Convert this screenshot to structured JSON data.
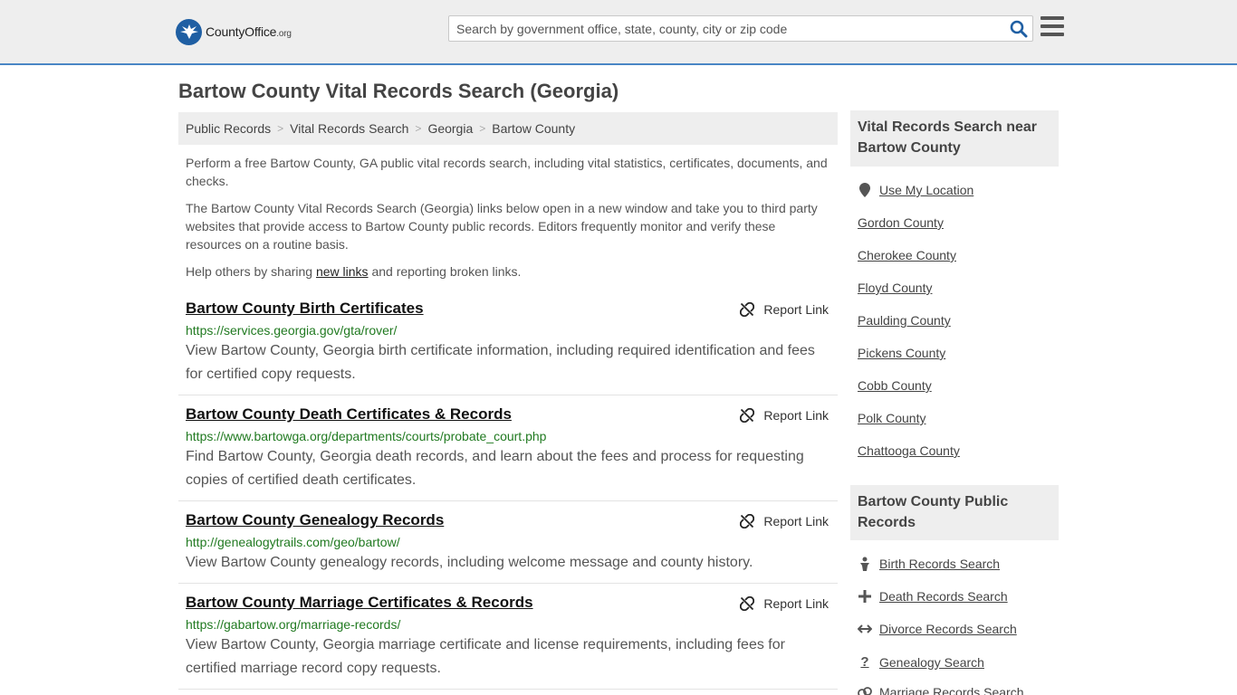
{
  "header": {
    "logo_brand": "CountyOffice",
    "logo_tld": ".org",
    "search_placeholder": "Search by government office, state, county, city or zip code"
  },
  "page_title": "Bartow County Vital Records Search (Georgia)",
  "breadcrumb": [
    "Public Records",
    "Vital Records Search",
    "Georgia",
    "Bartow County"
  ],
  "intro": {
    "p1": "Perform a free Bartow County, GA public vital records search, including vital statistics, certificates, documents, and checks.",
    "p2": "The Bartow County Vital Records Search (Georgia) links below open in a new window and take you to third party websites that provide access to Bartow County public records. Editors frequently monitor and verify these resources on a routine basis.",
    "p3_before": "Help others by sharing ",
    "p3_link": "new links",
    "p3_after": " and reporting broken links."
  },
  "report_label": "Report Link",
  "results": [
    {
      "title": "Bartow County Birth Certificates",
      "url": "https://services.georgia.gov/gta/rover/",
      "desc": "View Bartow County, Georgia birth certificate information, including required identification and fees for certified copy requests."
    },
    {
      "title": "Bartow County Death Certificates & Records",
      "url": "https://www.bartowga.org/departments/courts/probate_court.php",
      "desc": "Find Bartow County, Georgia death records, and learn about the fees and process for requesting copies of certified death certificates."
    },
    {
      "title": "Bartow County Genealogy Records",
      "url": "http://genealogytrails.com/geo/bartow/",
      "desc": "View Bartow County genealogy records, including welcome message and county history."
    },
    {
      "title": "Bartow County Marriage Certificates & Records",
      "url": "https://gabartow.org/marriage-records/",
      "desc": "View Bartow County, Georgia marriage certificate and license requirements, including fees for certified marriage record copy requests."
    }
  ],
  "sidebar": {
    "nearby_heading": "Vital Records Search near Bartow County",
    "use_location": "Use My Location",
    "nearby": [
      "Gordon County",
      "Cherokee County",
      "Floyd County",
      "Paulding County",
      "Pickens County",
      "Cobb County",
      "Polk County",
      "Chattooga County"
    ],
    "public_heading": "Bartow County Public Records",
    "public_links": [
      {
        "label": "Birth Records Search",
        "icon": "baby-icon"
      },
      {
        "label": "Death Records Search",
        "icon": "cross-icon"
      },
      {
        "label": "Divorce Records Search",
        "icon": "arrows-icon"
      },
      {
        "label": "Genealogy Search",
        "icon": "question-icon"
      },
      {
        "label": "Marriage Records Search",
        "icon": "rings-icon"
      }
    ]
  }
}
